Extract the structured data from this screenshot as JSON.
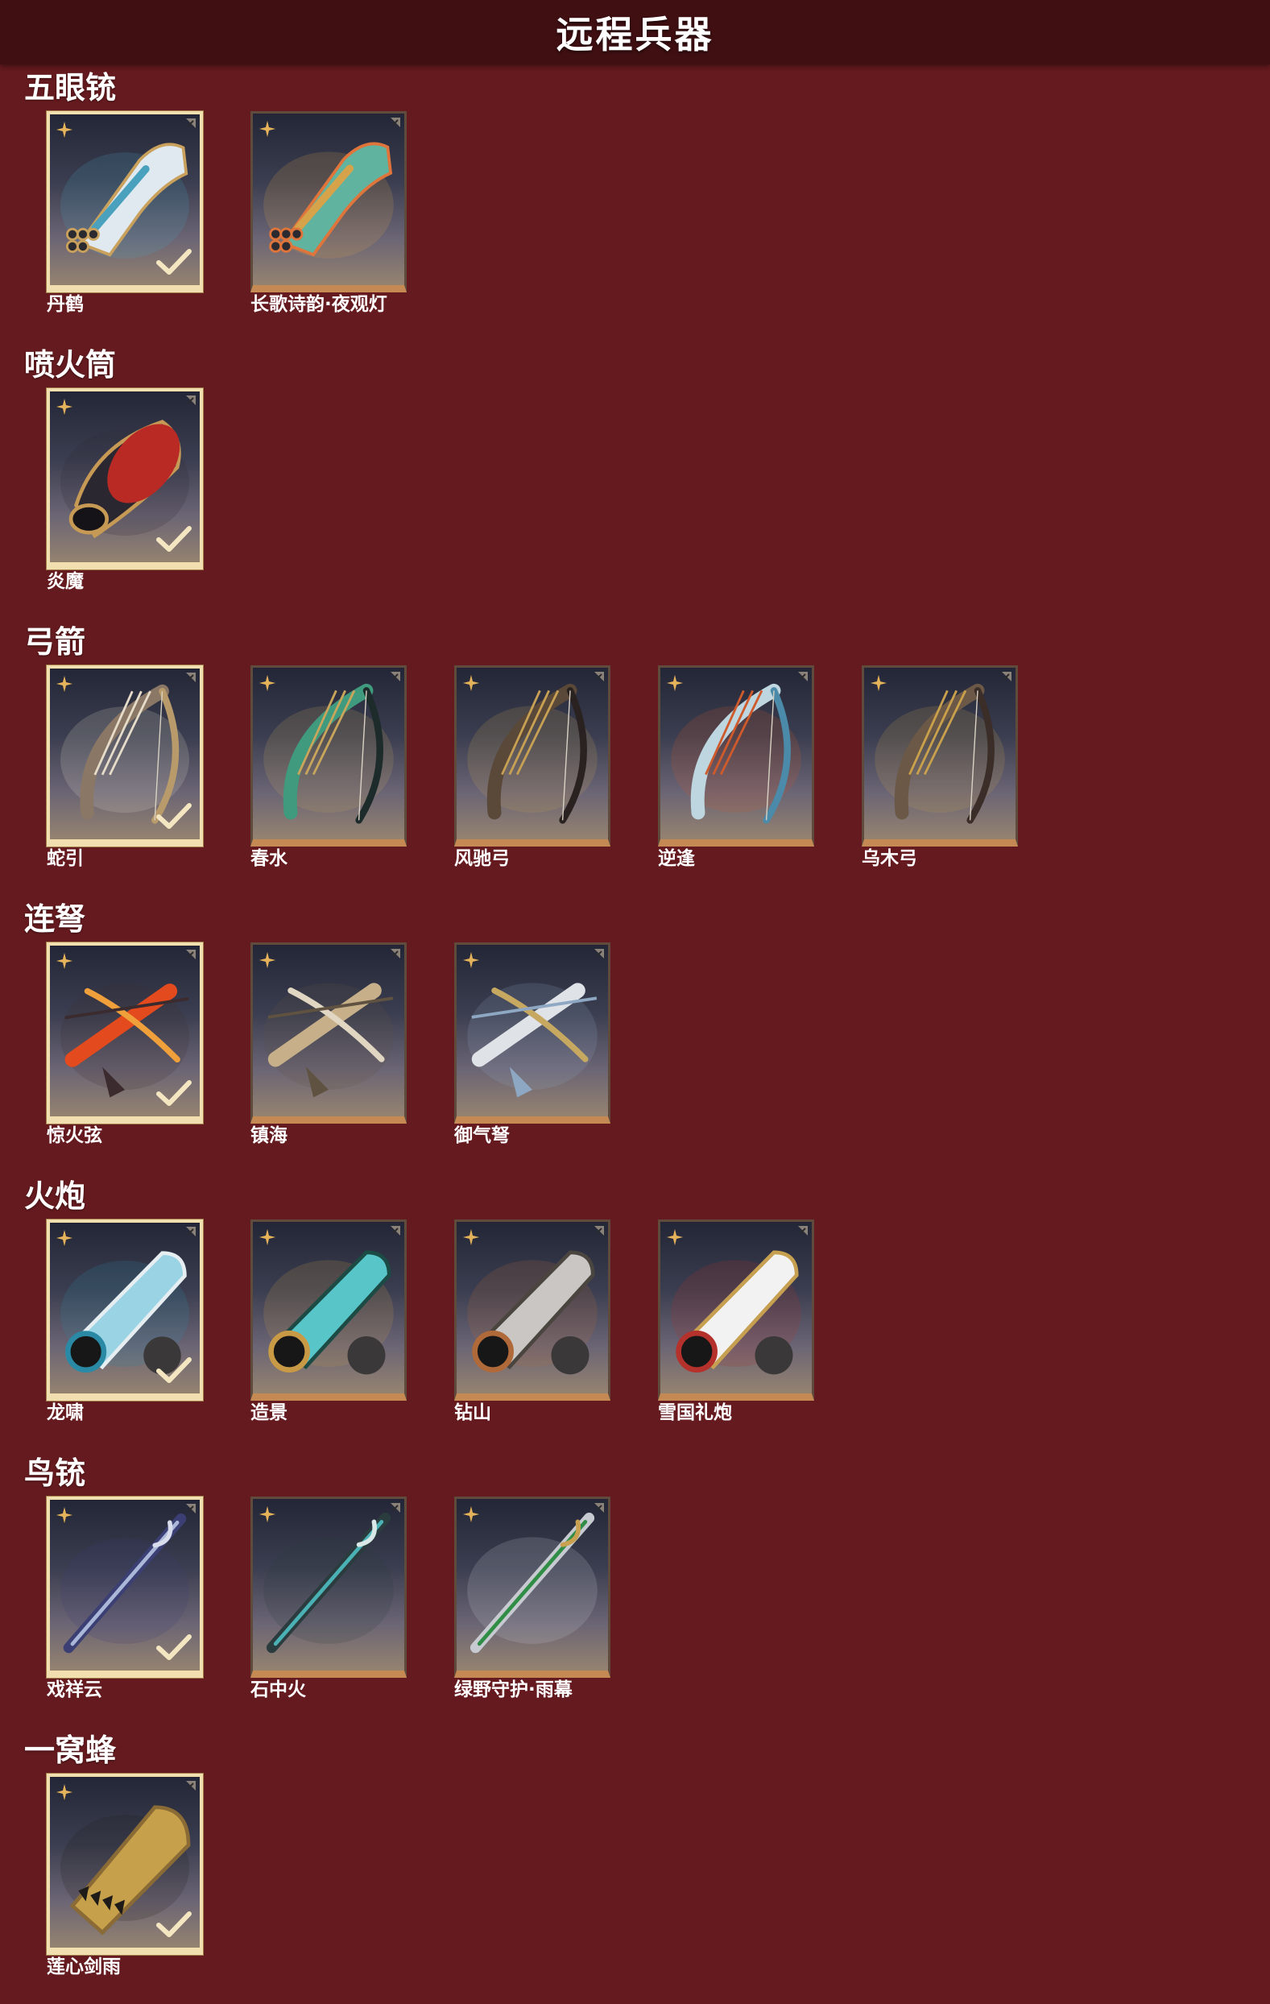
{
  "page_title": "远程兵器",
  "sections": [
    {
      "title": "五眼铳",
      "items": [
        {
          "name": "丹鹤",
          "selected": true,
          "palette": [
            "#dfe9ef",
            "#4aa1bd",
            "#c9a15c"
          ]
        },
        {
          "name": "长歌诗韵·夜观灯",
          "selected": false,
          "palette": [
            "#5fb39f",
            "#d6a34a",
            "#e0753b"
          ]
        }
      ]
    },
    {
      "title": "喷火筒",
      "items": [
        {
          "name": "炎魔",
          "selected": true,
          "palette": [
            "#b92a25",
            "#2b2730",
            "#c69a55"
          ]
        }
      ]
    },
    {
      "title": "弓箭",
      "items": [
        {
          "name": "蛇引",
          "selected": true,
          "palette": [
            "#8a7766",
            "#e6dcc9",
            "#b99a6a"
          ]
        },
        {
          "name": "春水",
          "selected": false,
          "palette": [
            "#3f9a7e",
            "#c9a55c",
            "#1d2b2a"
          ]
        },
        {
          "name": "风驰弓",
          "selected": false,
          "palette": [
            "#5a4838",
            "#c7a054",
            "#2a2220"
          ]
        },
        {
          "name": "逆逢",
          "selected": false,
          "palette": [
            "#bdd6df",
            "#cf5a2c",
            "#4b8aa8"
          ]
        },
        {
          "name": "乌木弓",
          "selected": false,
          "palette": [
            "#6b5846",
            "#c9a04c",
            "#3b2d27"
          ]
        }
      ]
    },
    {
      "title": "连弩",
      "items": [
        {
          "name": "惊火弦",
          "selected": true,
          "palette": [
            "#e34a1e",
            "#3b2a2e",
            "#f0a03a"
          ]
        },
        {
          "name": "镇海",
          "selected": false,
          "palette": [
            "#c7b089",
            "#5f5240",
            "#e0d6c2"
          ]
        },
        {
          "name": "御气弩",
          "selected": false,
          "palette": [
            "#dfe3e8",
            "#8ea7c3",
            "#c7a860"
          ]
        }
      ]
    },
    {
      "title": "火炮",
      "items": [
        {
          "name": "龙啸",
          "selected": true,
          "palette": [
            "#9ad4e4",
            "#2a8aa6",
            "#e6eef2"
          ]
        },
        {
          "name": "造景",
          "selected": false,
          "palette": [
            "#58c6c9",
            "#c99a46",
            "#1c4a45"
          ]
        },
        {
          "name": "钻山",
          "selected": false,
          "palette": [
            "#c9c6c4",
            "#b06a3a",
            "#4b4540"
          ]
        },
        {
          "name": "雪国礼炮",
          "selected": false,
          "palette": [
            "#f2f2f2",
            "#b4312c",
            "#c6a050"
          ]
        }
      ]
    },
    {
      "title": "鸟铳",
      "items": [
        {
          "name": "戏祥云",
          "selected": true,
          "palette": [
            "#aab7d8",
            "#3b3f74",
            "#d8dceb"
          ]
        },
        {
          "name": "石中火",
          "selected": false,
          "palette": [
            "#4ab1b4",
            "#2b3c3f",
            "#d7e8e6"
          ]
        },
        {
          "name": "绿野守护·雨幕",
          "selected": false,
          "palette": [
            "#2f8d45",
            "#c7cbd1",
            "#c9a050"
          ]
        }
      ]
    },
    {
      "title": "一窝蜂",
      "items": [
        {
          "name": "莲心剑雨",
          "selected": true,
          "palette": [
            "#c6a04a",
            "#1f1b18",
            "#8a6a35"
          ]
        }
      ]
    }
  ],
  "colors": {
    "background": "#641a1e",
    "header_background": "#3f0f12",
    "card_border": "#c58a54",
    "selected_border": "#f1dfb0",
    "sparkle": "#e5b35a"
  },
  "icons": {
    "sparkle": "four-point-star-icon",
    "corner": "corner-fold-icon",
    "check": "checkmark-icon"
  }
}
